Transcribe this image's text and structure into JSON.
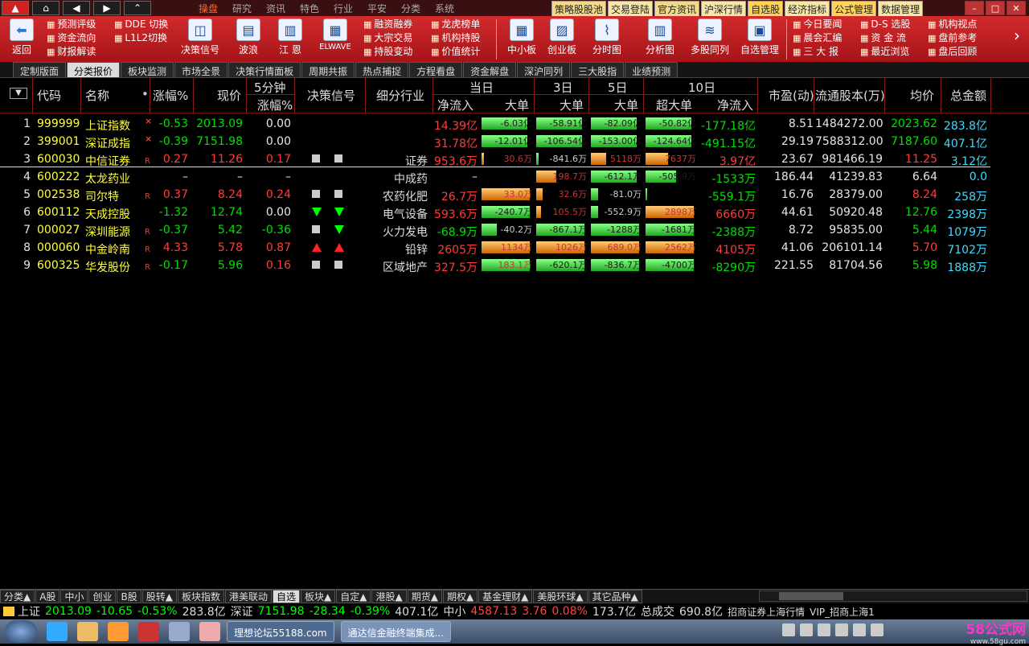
{
  "menu": [
    "操盘",
    "研究",
    "资讯",
    "特色",
    "行业",
    "平安",
    "分类",
    "系统"
  ],
  "menu_active": 0,
  "top_links": [
    "策略股股池",
    "交易登陆",
    "官方资讯",
    "沪深行情",
    "自选股",
    "经济指标",
    "公式管理",
    "数据管理"
  ],
  "toolbar": {
    "back": "返回",
    "col1": [
      "预测评级",
      "资金流向",
      "财报解读"
    ],
    "col2": [
      "DDE 切换",
      "L1L2切换"
    ],
    "big1": [
      "决策信号",
      "波浪",
      "江 恩",
      "ELWAVE"
    ],
    "col3": [
      "融资融券",
      "大宗交易",
      "持股变动"
    ],
    "col4": [
      "龙虎榜单",
      "机构持股",
      "价值统计"
    ],
    "big2": [
      "中小板",
      "创业板",
      "分时图",
      "分析图",
      "多股同列",
      "自选管理"
    ],
    "col5": [
      "今日要闻",
      "晨会汇编",
      "三 大 报"
    ],
    "col6": [
      "D-S 选股",
      "资 金 流",
      "最近浏览"
    ],
    "col7": [
      "机构视点",
      "盘前参考",
      "盘后回顾"
    ]
  },
  "tabs": [
    "定制版面",
    "分类报价",
    "板块监测",
    "市场全景",
    "决策行情面板",
    "周期共振",
    "热点捕捉",
    "方程看盘",
    "资金解盘",
    "深沪同列",
    "三大股指",
    "业绩预测"
  ],
  "active_tab": 1,
  "header": {
    "code": "代码",
    "name": "名称",
    "chg": "涨幅%",
    "price": "现价",
    "min5": "5分钟",
    "min5_chg": "涨幅%",
    "signal": "决策信号",
    "industry": "细分行业",
    "today": "当日",
    "d3": "3日",
    "d5": "5日",
    "d10": "10日",
    "netflow": "净流入",
    "bigorder": "大单",
    "superbig": "超大单",
    "pe": "市盈(动)",
    "float": "流通股本(万)",
    "avg": "均价",
    "amount": "总金额"
  },
  "rows": [
    {
      "n": "1",
      "code": "999999",
      "name": "上证指数",
      "flag": "×",
      "chg": "-0.53",
      "price": "2013.09",
      "m5": "0.00",
      "sig": [
        "",
        ""
      ],
      "ind": "",
      "net": "14.39亿",
      "b1": {
        "v": "-6.03亿",
        "t": "g",
        "w": 0.9
      },
      "b3": {
        "v": "-58.91亿",
        "t": "g",
        "w": 0.9
      },
      "b5": {
        "v": "-82.09亿",
        "t": "g",
        "w": 0.9
      },
      "b10s": {
        "v": "-50.82亿",
        "t": "g",
        "w": 0.9
      },
      "net10": "-177.18亿",
      "pe": "8.51",
      "float": "1484272.00",
      "avg": "2023.62",
      "amt": "283.8亿"
    },
    {
      "n": "2",
      "code": "399001",
      "name": "深证成指",
      "flag": "×",
      "chg": "-0.39",
      "price": "7151.98",
      "m5": "0.00",
      "sig": [
        "",
        ""
      ],
      "ind": "",
      "net": "31.78亿",
      "b1": {
        "v": "-12.01亿",
        "t": "g",
        "w": 0.9
      },
      "b3": {
        "v": "-106.54亿",
        "t": "g",
        "w": 0.9
      },
      "b5": {
        "v": "-153.00亿",
        "t": "g",
        "w": 0.9
      },
      "b10s": {
        "v": "-124.64亿",
        "t": "g",
        "w": 0.9
      },
      "net10": "-491.15亿",
      "pe": "29.19",
      "float": "7588312.00",
      "avg": "7187.60",
      "amt": "407.1亿"
    },
    {
      "n": "3",
      "code": "600030",
      "name": "中信证券",
      "flag": "R",
      "chg": "0.27",
      "price": "11.26",
      "m5": "0.17",
      "sig": [
        "sq",
        "sq"
      ],
      "ind": "证券",
      "net": "953.6万",
      "b1": {
        "v": "30.6万",
        "t": "o",
        "w": 0.05
      },
      "b3": {
        "v": "-841.6万",
        "t": "g",
        "w": 0.05
      },
      "b5": {
        "v": "5118万",
        "t": "o",
        "w": 0.3
      },
      "b10s": {
        "v": "7637万",
        "t": "o",
        "w": 0.45
      },
      "net10": "3.97亿",
      "pe": "23.67",
      "float": "981466.19",
      "avg": "11.25",
      "amt": "3.12亿"
    },
    {
      "n": "4",
      "code": "600222",
      "name": "太龙药业",
      "flag": "",
      "chg": "–",
      "price": "–",
      "m5": "–",
      "sig": [
        "",
        ""
      ],
      "ind": "中成药",
      "net": "–",
      "b1": null,
      "b3": {
        "v": "198.7万",
        "t": "o",
        "w": 0.4
      },
      "b5": {
        "v": "-612.1万",
        "t": "g",
        "w": 0.9
      },
      "b10s": {
        "v": "-505.9万",
        "t": "g",
        "w": 0.6
      },
      "net10": "-1533万",
      "pe": "186.44",
      "float": "41239.83",
      "avg": "6.64",
      "amt": "0.0"
    },
    {
      "n": "5",
      "code": "002538",
      "name": "司尔特",
      "flag": "R",
      "chg": "0.37",
      "price": "8.24",
      "m5": "0.24",
      "sig": [
        "sq",
        "sq"
      ],
      "ind": "农药化肥",
      "net": "26.7万",
      "b1": {
        "v": "33.0万",
        "t": "o",
        "w": 0.95
      },
      "b3": {
        "v": "32.6万",
        "t": "o",
        "w": 0.12
      },
      "b5": {
        "v": "-81.0万",
        "t": "g",
        "w": 0.15
      },
      "b10s": {
        "v": "",
        "t": "g",
        "w": 0.02
      },
      "net10": "-559.1万",
      "pe": "16.76",
      "float": "28379.00",
      "avg": "8.24",
      "amt": "258万"
    },
    {
      "n": "6",
      "code": "600112",
      "name": "天成控股",
      "flag": "",
      "chg": "-1.32",
      "price": "12.74",
      "m5": "0.00",
      "sig": [
        "down",
        "down"
      ],
      "ind": "电气设备",
      "net": "593.6万",
      "b1": {
        "v": "-240.7万",
        "t": "g",
        "w": 0.95
      },
      "b3": {
        "v": "105.5万",
        "t": "o",
        "w": 0.1
      },
      "b5": {
        "v": "-552.9万",
        "t": "g",
        "w": 0.15
      },
      "b10s": {
        "v": "2898万",
        "t": "o",
        "w": 0.95
      },
      "net10": "6660万",
      "pe": "44.61",
      "float": "50920.48",
      "avg": "12.76",
      "amt": "2398万"
    },
    {
      "n": "7",
      "code": "000027",
      "name": "深圳能源",
      "flag": "R",
      "chg": "-0.37",
      "price": "5.42",
      "m5": "-0.36",
      "sig": [
        "sq",
        "down"
      ],
      "ind": "火力发电",
      "net": "-68.9万",
      "b1": {
        "v": "-40.2万",
        "t": "g",
        "w": 0.3
      },
      "b3": {
        "v": "-867.1万",
        "t": "g",
        "w": 0.95
      },
      "b5": {
        "v": "-1288万",
        "t": "g",
        "w": 0.95
      },
      "b10s": {
        "v": "-1681万",
        "t": "g",
        "w": 0.95
      },
      "net10": "-2388万",
      "pe": "8.72",
      "float": "95835.00",
      "avg": "5.44",
      "amt": "1079万"
    },
    {
      "n": "8",
      "code": "000060",
      "name": "中金岭南",
      "flag": "R",
      "chg": "4.33",
      "price": "5.78",
      "m5": "0.87",
      "sig": [
        "up",
        "up"
      ],
      "ind": "铅锌",
      "net": "2605万",
      "b1": {
        "v": "1134万",
        "t": "o",
        "w": 0.95
      },
      "b3": {
        "v": "1026万",
        "t": "o",
        "w": 0.95
      },
      "b5": {
        "v": "689.0万",
        "t": "o",
        "w": 0.95
      },
      "b10s": {
        "v": "2562万",
        "t": "o",
        "w": 0.95
      },
      "net10": "4105万",
      "pe": "41.06",
      "float": "206101.14",
      "avg": "5.70",
      "amt": "7102万"
    },
    {
      "n": "9",
      "code": "600325",
      "name": "华发股份",
      "flag": "R",
      "chg": "-0.17",
      "price": "5.96",
      "m5": "0.16",
      "sig": [
        "sq",
        "sq"
      ],
      "ind": "区域地产",
      "net": "327.5万",
      "b1": {
        "v": "183.1万",
        "t": "g",
        "w": 0.95
      },
      "b3": {
        "v": "-620.1万",
        "t": "g",
        "w": 0.95
      },
      "b5": {
        "v": "-836.7万",
        "t": "g",
        "w": 0.95
      },
      "b10s": {
        "v": "-4700万",
        "t": "g",
        "w": 0.95
      },
      "net10": "-8290万",
      "pe": "221.55",
      "float": "81704.56",
      "avg": "5.98",
      "amt": "1888万"
    }
  ],
  "bottom_tabs": [
    "分类▲",
    "A股",
    "中小",
    "创业",
    "B股",
    "股转▲",
    "板块指数",
    "港美联动",
    "自选",
    "板块▲",
    "自定▲",
    "港股▲",
    "期货▲",
    "期权▲",
    "基金理财▲",
    "美股环球▲",
    "其它品种▲"
  ],
  "bottom_active": 8,
  "status": [
    {
      "t": "上证",
      "c": "#ddd"
    },
    {
      "t": "2013.09",
      "c": "#0f0"
    },
    {
      "t": "-10.65",
      "c": "#0f0"
    },
    {
      "t": "-0.53%",
      "c": "#0f0"
    },
    {
      "t": "283.8亿",
      "c": "#ddd"
    },
    {
      "t": "深证",
      "c": "#ddd"
    },
    {
      "t": "7151.98",
      "c": "#0f0"
    },
    {
      "t": "-28.34",
      "c": "#0f0"
    },
    {
      "t": "-0.39%",
      "c": "#0f0"
    },
    {
      "t": "407.1亿",
      "c": "#ddd"
    },
    {
      "t": "中小",
      "c": "#ddd"
    },
    {
      "t": "4587.13",
      "c": "#f44"
    },
    {
      "t": "3.76",
      "c": "#f44"
    },
    {
      "t": "0.08%",
      "c": "#f44"
    },
    {
      "t": "173.7亿",
      "c": "#ddd"
    },
    {
      "t": "总成交",
      "c": "#ddd"
    },
    {
      "t": "690.8亿",
      "c": "#ddd"
    },
    {
      "t": "招商证券上海行情",
      "c": "#ddd"
    },
    {
      "t": "VIP_招商上海1",
      "c": "#ddd"
    }
  ],
  "taskbar": [
    "理想论坛55188.com",
    "通达信金融终端集成..."
  ],
  "watermark": "58公式网",
  "watermark_url": "www.58gu.com",
  "colors": {
    "up": "#ff3c3c",
    "down": "#00e000",
    "yellow": "#ffff3c",
    "cyan": "#3cdcff",
    "white": "#e6e6e6"
  }
}
